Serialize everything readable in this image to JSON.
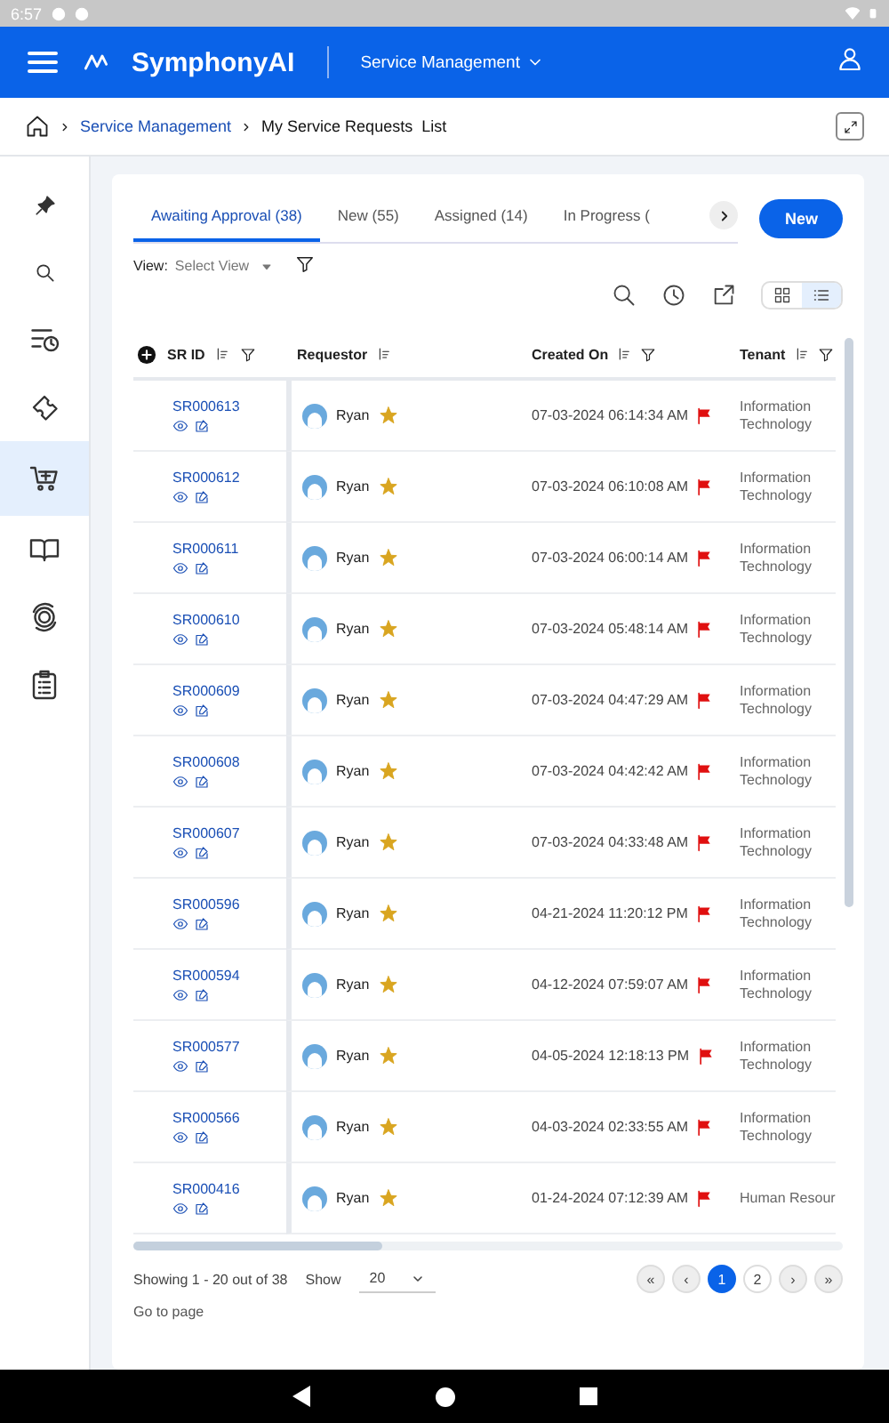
{
  "status_bar": {
    "time": "6:57"
  },
  "header": {
    "brand": "SymphonyAI",
    "module": "Service Management"
  },
  "breadcrumb": {
    "link": "Service Management",
    "current": "My Service Requests",
    "suffix": "List"
  },
  "sidebar": {
    "items": [
      {
        "kind": "pin",
        "selected": false
      },
      {
        "kind": "search",
        "selected": false
      },
      {
        "kind": "history",
        "selected": false
      },
      {
        "kind": "ticket",
        "selected": false
      },
      {
        "kind": "cart",
        "selected": true
      },
      {
        "kind": "book",
        "selected": false
      },
      {
        "kind": "gear",
        "selected": false
      },
      {
        "kind": "clipboard",
        "selected": false
      }
    ]
  },
  "tabs": [
    {
      "label": "Awaiting Approval (38)",
      "selected": true
    },
    {
      "label": "New (55)",
      "selected": false
    },
    {
      "label": "Assigned (14)",
      "selected": false
    },
    {
      "label": "In Progress (",
      "selected": false
    }
  ],
  "new_button": "New",
  "view": {
    "label": "View:",
    "placeholder": "Select View"
  },
  "table": {
    "columns": [
      "SR ID",
      "Requestor",
      "Created On",
      "Tenant"
    ],
    "rows": [
      {
        "id": "SR000613",
        "requestor": "Ryan",
        "created": "07-03-2024 06:14:34 AM",
        "tenant": "Information Technology"
      },
      {
        "id": "SR000612",
        "requestor": "Ryan",
        "created": "07-03-2024 06:10:08 AM",
        "tenant": "Information Technology"
      },
      {
        "id": "SR000611",
        "requestor": "Ryan",
        "created": "07-03-2024 06:00:14 AM",
        "tenant": "Information Technology"
      },
      {
        "id": "SR000610",
        "requestor": "Ryan",
        "created": "07-03-2024 05:48:14 AM",
        "tenant": "Information Technology"
      },
      {
        "id": "SR000609",
        "requestor": "Ryan",
        "created": "07-03-2024 04:47:29 AM",
        "tenant": "Information Technology"
      },
      {
        "id": "SR000608",
        "requestor": "Ryan",
        "created": "07-03-2024 04:42:42 AM",
        "tenant": "Information Technology"
      },
      {
        "id": "SR000607",
        "requestor": "Ryan",
        "created": "07-03-2024 04:33:48 AM",
        "tenant": "Information Technology"
      },
      {
        "id": "SR000596",
        "requestor": "Ryan",
        "created": "04-21-2024 11:20:12 PM",
        "tenant": "Information Technology"
      },
      {
        "id": "SR000594",
        "requestor": "Ryan",
        "created": "04-12-2024 07:59:07 AM",
        "tenant": "Information Technology"
      },
      {
        "id": "SR000577",
        "requestor": "Ryan",
        "created": "04-05-2024 12:18:13 PM",
        "tenant": "Information Technology"
      },
      {
        "id": "SR000566",
        "requestor": "Ryan",
        "created": "04-03-2024 02:33:55 AM",
        "tenant": "Information Technology"
      },
      {
        "id": "SR000416",
        "requestor": "Ryan",
        "created": "01-24-2024 07:12:39 AM",
        "tenant": "Human Resour"
      }
    ]
  },
  "footer": {
    "showing": "Showing 1 - 20 out of 38",
    "show_label": "Show",
    "page_size": "20",
    "go_to_page": "Go to page"
  },
  "pager": [
    {
      "label": "«",
      "kind": "nav",
      "selected": false
    },
    {
      "label": "‹",
      "kind": "nav",
      "selected": false
    },
    {
      "label": "1",
      "kind": "page",
      "selected": true
    },
    {
      "label": "2",
      "kind": "page",
      "selected": false
    },
    {
      "label": "›",
      "kind": "nav",
      "selected": false
    },
    {
      "label": "»",
      "kind": "nav",
      "selected": false
    }
  ]
}
